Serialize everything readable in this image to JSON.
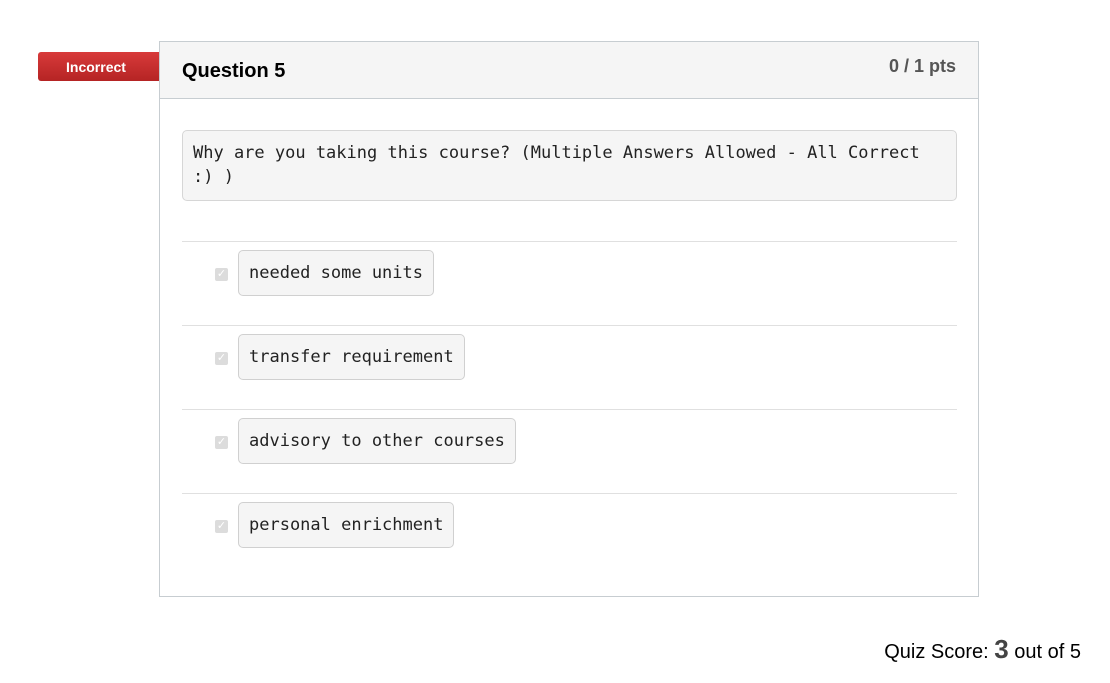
{
  "result_flag": "Incorrect",
  "question": {
    "title": "Question 5",
    "points": "0 / 1 pts",
    "text": "Why are you taking this course? (Multiple Answers Allowed - All Correct :) )",
    "answers": [
      {
        "label": "needed some units",
        "checked": true
      },
      {
        "label": "transfer requirement",
        "checked": true
      },
      {
        "label": "advisory to other courses",
        "checked": true
      },
      {
        "label": "personal enrichment",
        "checked": true
      }
    ]
  },
  "quiz_score": {
    "prefix": "Quiz Score:",
    "score": "3",
    "suffix": "out of 5"
  },
  "icons": {
    "checkbox": "checkmark-icon"
  },
  "colors": {
    "incorrect_flag": "#c8302f"
  }
}
